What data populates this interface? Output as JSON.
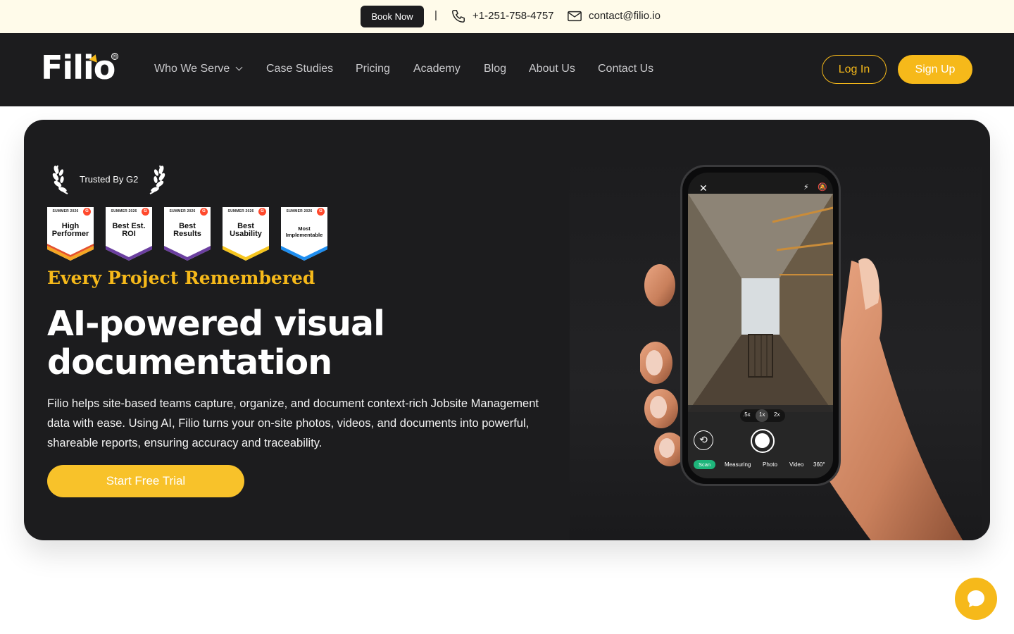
{
  "topbar": {
    "book_label": "Book Now",
    "separator": "|",
    "phone": "+1-251-758-4757",
    "email": "contact@filio.io"
  },
  "nav": {
    "logo": "Filio",
    "logo_mark": "®",
    "items": [
      "Who We Serve",
      "Case Studies",
      "Pricing",
      "Academy",
      "Blog",
      "About Us",
      "Contact Us"
    ],
    "login_label": "Log In",
    "signup_label": "Sign Up"
  },
  "hero": {
    "trusted": "Trusted By G2",
    "badges": [
      {
        "season": "SUMMER 2026",
        "title": "High Performer",
        "color": "#f5a623"
      },
      {
        "season": "SUMMER 2026",
        "title": "Best Est. ROI",
        "color": "#6b3fa0"
      },
      {
        "season": "SUMMER 2026",
        "title": "Best Results",
        "color": "#6b3fa0"
      },
      {
        "season": "SUMMER 2026",
        "title": "Best Usability",
        "color": "#f6c51e"
      },
      {
        "season": "SUMMER 2026",
        "title": "Most Implementable",
        "color": "#1e8ef0"
      }
    ],
    "eyebrow": "Every Project Remembered",
    "headline": "AI-powered visual documentation",
    "description": "Filio helps site-based teams capture, organize, and document context-rich Jobsite Management data with ease. Using AI, Filio turns your on-site photos, videos, and documents into powerful, shareable reports, ensuring accuracy and traceability.",
    "cta_label": "Start Free Trial"
  },
  "phone_ui": {
    "zoom": [
      ".5x",
      "1x",
      "2x"
    ],
    "modes": [
      "Scan",
      "Measuring",
      "Photo",
      "Video",
      "360°"
    ],
    "close": "✕"
  },
  "colors": {
    "accent": "#f6b91a",
    "nav_bg": "#1c1c1e",
    "topbar_bg": "#fffbea",
    "scan_green": "#1eb67b"
  }
}
